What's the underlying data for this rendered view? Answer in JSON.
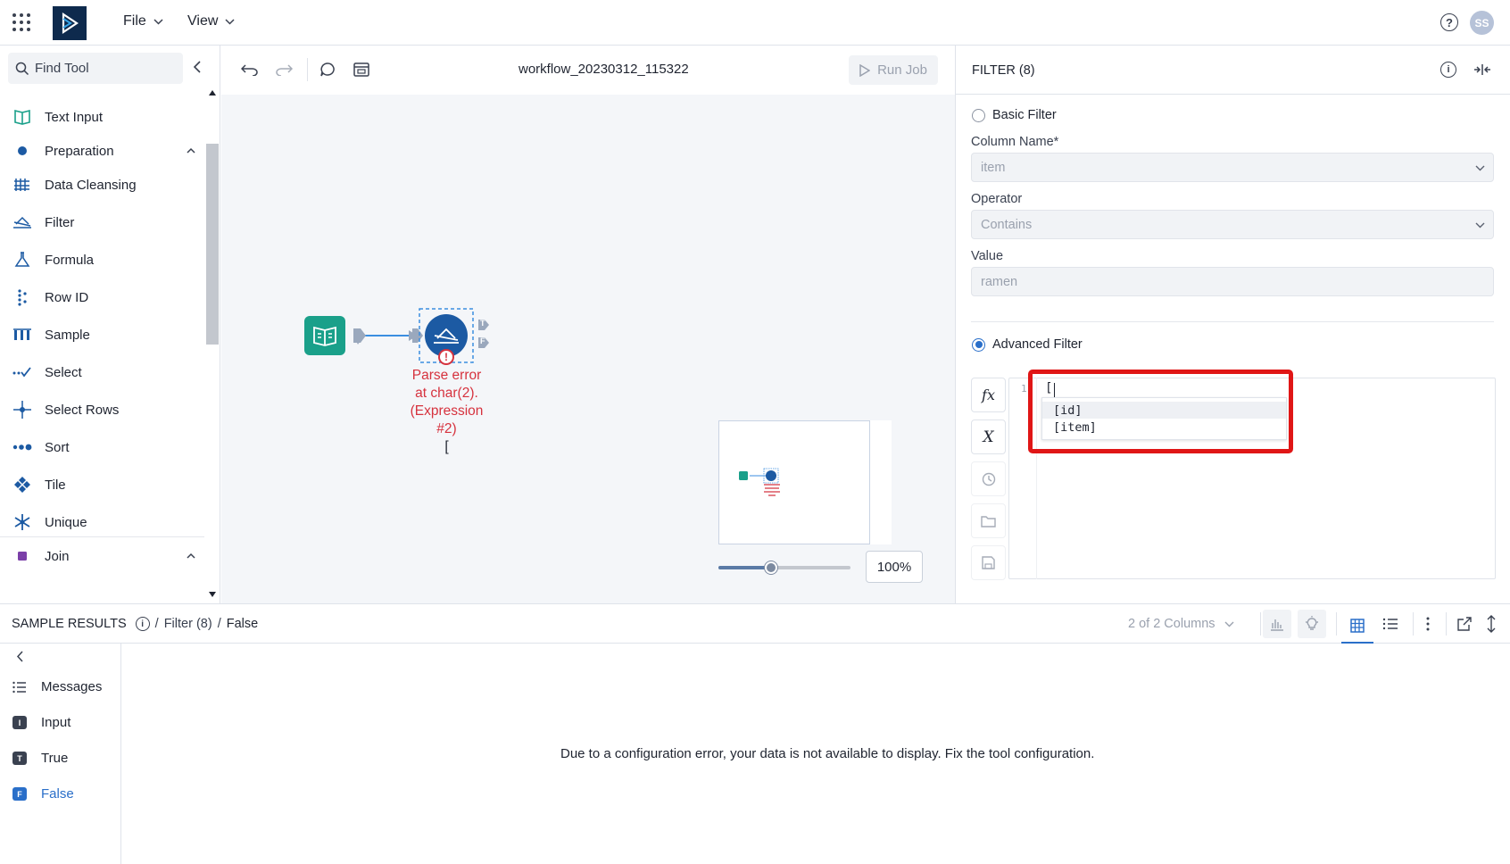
{
  "topbar": {
    "menus": [
      "File",
      "View"
    ],
    "avatar_initials": "SS",
    "help_glyph": "?"
  },
  "sidebar": {
    "search_placeholder": "Find Tool",
    "items": [
      {
        "label": "Text Input",
        "icon": "book-icon"
      },
      {
        "label": "Preparation",
        "icon": "dot-icon",
        "section": true
      },
      {
        "label": "Data Cleansing",
        "icon": "data-cleansing-icon"
      },
      {
        "label": "Filter",
        "icon": "filter-icon"
      },
      {
        "label": "Formula",
        "icon": "flask-icon"
      },
      {
        "label": "Row ID",
        "icon": "row-id-icon"
      },
      {
        "label": "Sample",
        "icon": "sample-icon"
      },
      {
        "label": "Select",
        "icon": "select-icon"
      },
      {
        "label": "Select Rows",
        "icon": "select-rows-icon"
      },
      {
        "label": "Sort",
        "icon": "sort-icon"
      },
      {
        "label": "Tile",
        "icon": "tile-icon"
      },
      {
        "label": "Unique",
        "icon": "unique-icon"
      },
      {
        "label": "Join",
        "icon": "square-icon",
        "section": true
      }
    ]
  },
  "canvas": {
    "workflow_title": "workflow_20230312_115322",
    "run_job_label": "Run Job",
    "error_lines": [
      "Parse error",
      "at char(2).",
      "(Expression",
      "#2)",
      "["
    ],
    "anchor_true": "T",
    "anchor_false": "F",
    "zoom": "100%",
    "zoom_fraction": 0.4
  },
  "config": {
    "title": "FILTER (8)",
    "basic_filter_label": "Basic Filter",
    "column_name_label": "Column Name*",
    "column_name_value": "item",
    "operator_label": "Operator",
    "operator_value": "Contains",
    "value_label": "Value",
    "value_value": "ramen",
    "advanced_filter_label": "Advanced Filter",
    "editor_line_number": "1",
    "editor_text": "[",
    "autocomplete": [
      "[id]",
      "[item]"
    ],
    "side_buttons": [
      "fx",
      "X"
    ]
  },
  "results": {
    "title": "SAMPLE RESULTS",
    "breadcrumb_tool": "Filter (8)",
    "breadcrumb_output": "False",
    "columns_label": "2 of 2 Columns",
    "nav": [
      {
        "label": "Messages",
        "icon": "list-icon"
      },
      {
        "label": "Input",
        "badge": "I"
      },
      {
        "label": "True",
        "badge": "T"
      },
      {
        "label": "False",
        "badge": "F",
        "active": true
      }
    ],
    "empty_message": "Due to a configuration error, your data is not available to display. Fix the tool configuration."
  },
  "colors": {
    "accent": "#2a6fc9",
    "error": "#d6323e",
    "highlight": "#e01616",
    "text_input_node": "#1aa08a",
    "filter_node": "#1c5aa3"
  }
}
